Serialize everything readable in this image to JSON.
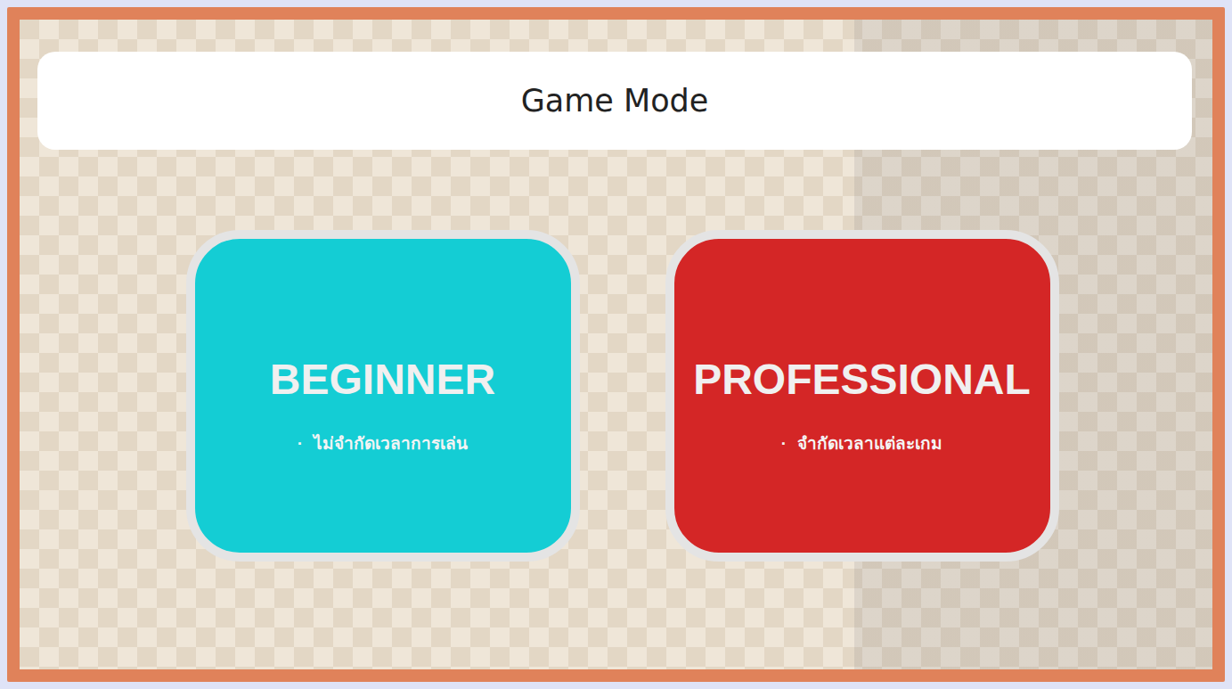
{
  "header": {
    "title": "Game Mode"
  },
  "modes": [
    {
      "title": "BEGINNER",
      "bullet": "·",
      "description": "ไม่จำกัดเวลาการเล่น",
      "color": "#14cdd4"
    },
    {
      "title": "PROFESSIONAL",
      "bullet": "·",
      "description": "จำกัดเวลาแต่ละเกม",
      "color": "#d42626"
    }
  ]
}
